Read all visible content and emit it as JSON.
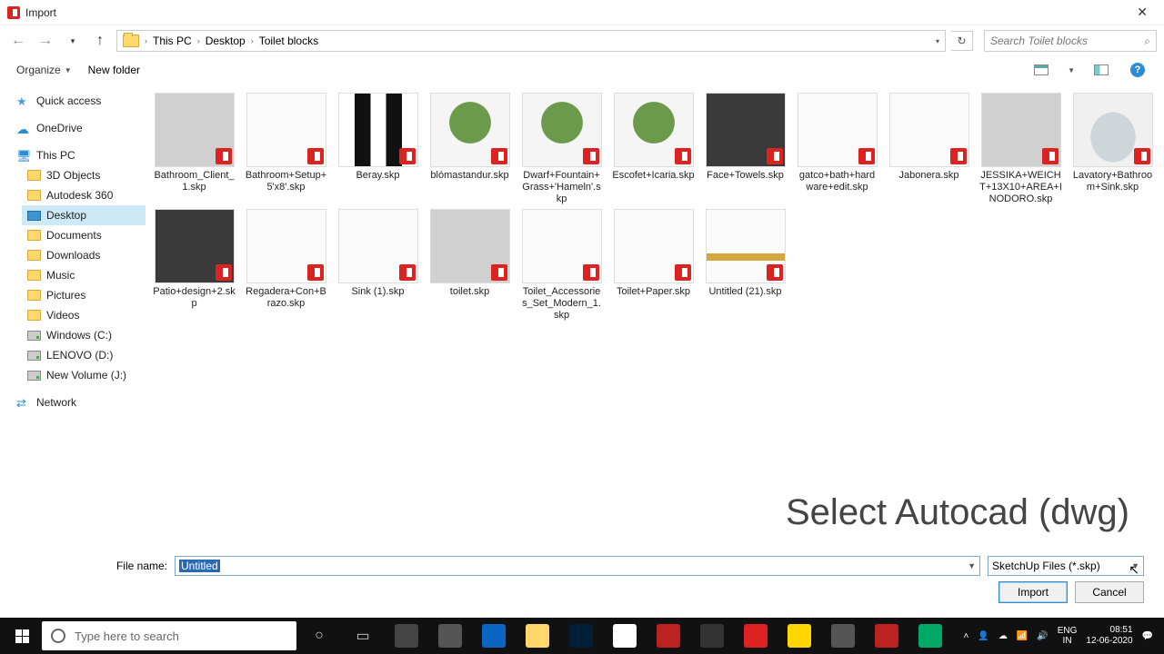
{
  "titlebar": {
    "title": "Import"
  },
  "breadcrumb": {
    "items": [
      "This PC",
      "Desktop",
      "Toilet blocks"
    ]
  },
  "search": {
    "placeholder": "Search Toilet blocks"
  },
  "toolbar": {
    "organize": "Organize",
    "newfolder": "New folder"
  },
  "sidebar": {
    "quick": "Quick access",
    "onedrive": "OneDrive",
    "thispc": "This PC",
    "sub": [
      "3D Objects",
      "Autodesk 360",
      "Desktop",
      "Documents",
      "Downloads",
      "Music",
      "Pictures",
      "Videos",
      "Windows (C:)",
      "LENOVO (D:)",
      "New Volume (J:)"
    ],
    "network": "Network"
  },
  "files": [
    {
      "name": "Bathroom_Client_1.skp",
      "th": "th-gray"
    },
    {
      "name": "Bathroom+Setup+5'x8'.skp",
      "th": "th-white"
    },
    {
      "name": "Beray.skp",
      "th": "th-bw"
    },
    {
      "name": "blómastandur.skp",
      "th": "th-plant"
    },
    {
      "name": "Dwarf+Fountain+Grass+'Hameln'.skp",
      "th": "th-plant"
    },
    {
      "name": "Escofet+Icaria.skp",
      "th": "th-plant"
    },
    {
      "name": "Face+Towels.skp",
      "th": "th-dark"
    },
    {
      "name": "gatco+bath+hardware+edit.skp",
      "th": "th-white"
    },
    {
      "name": "Jabonera.skp",
      "th": "th-white"
    },
    {
      "name": "JESSIKA+WEICHT+13X10+AREA+INODORO.skp",
      "th": "th-gray"
    },
    {
      "name": "Lavatory+Bathroom+Sink.skp",
      "th": "th-sink"
    },
    {
      "name": "Patio+design+2.skp",
      "th": "th-dark"
    },
    {
      "name": "Regadera+Con+Brazo.skp",
      "th": "th-white"
    },
    {
      "name": "Sink (1).skp",
      "th": "th-white"
    },
    {
      "name": "toilet.skp",
      "th": "th-gray"
    },
    {
      "name": "Toilet_Accessories_Set_Modern_1.skp",
      "th": "th-white"
    },
    {
      "name": "Toilet+Paper.skp",
      "th": "th-white"
    },
    {
      "name": "Untitled (21).skp",
      "th": "th-gold"
    }
  ],
  "overlay": "Select Autocad (dwg)",
  "footer": {
    "label": "File name:",
    "value": "Untitled",
    "filter": "SketchUp Files (*.skp)",
    "import": "Import",
    "cancel": "Cancel"
  },
  "taskbar": {
    "search": "Type here to search",
    "lang1": "ENG",
    "lang2": "IN",
    "time": "08:51",
    "date": "12-06-2020"
  }
}
